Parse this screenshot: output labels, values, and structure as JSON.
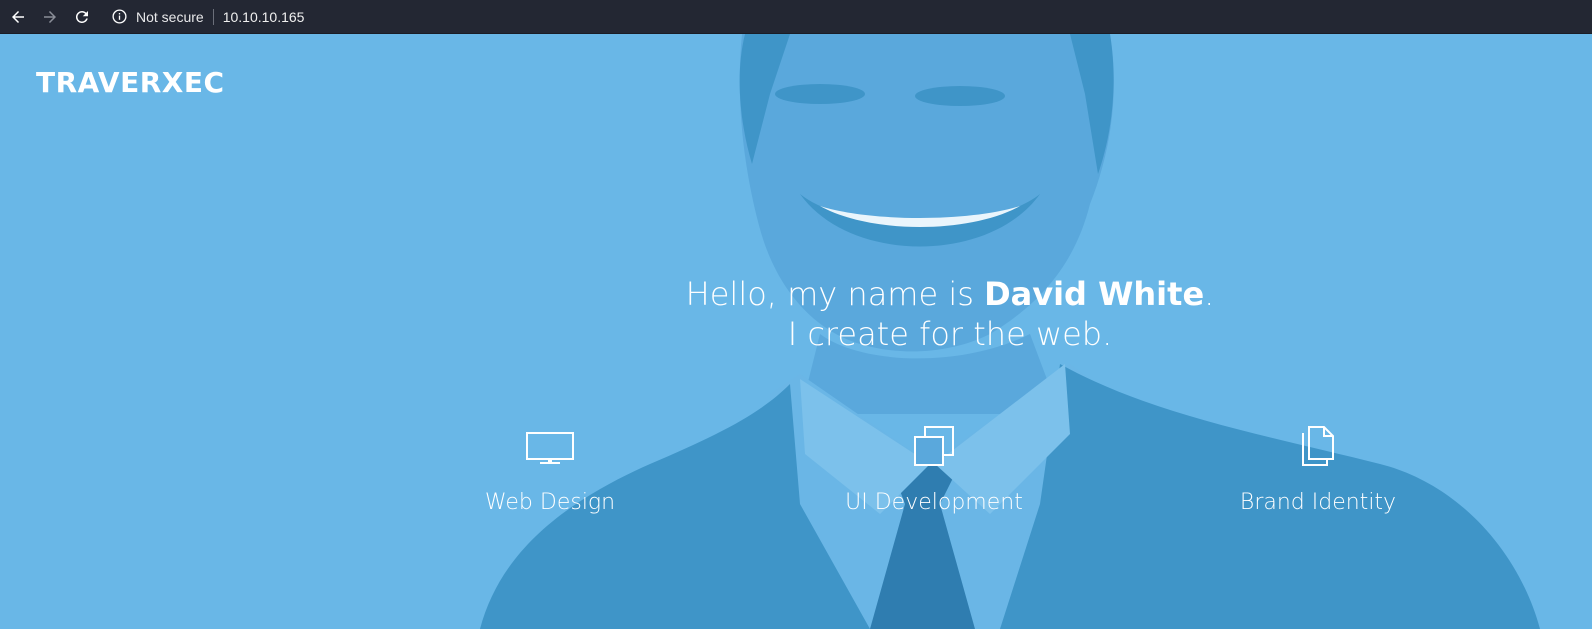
{
  "browser": {
    "security_label": "Not secure",
    "url": "10.10.10.165"
  },
  "site": {
    "brand": "TRAVERXEC",
    "headline": {
      "greeting": "Hello, my name is ",
      "name": "David White",
      "period": ".",
      "line2": "I create for the web."
    },
    "services": [
      {
        "label": "Web Design",
        "icon": "monitor-icon"
      },
      {
        "label": "UI Development",
        "icon": "layers-icon"
      },
      {
        "label": "Brand Identity",
        "icon": "documents-icon"
      }
    ]
  },
  "colors": {
    "hero_bg": "#69b7e7",
    "hero_shadow": "#3f95c8",
    "browser_bar": "#232733",
    "text": "#ffffff"
  }
}
